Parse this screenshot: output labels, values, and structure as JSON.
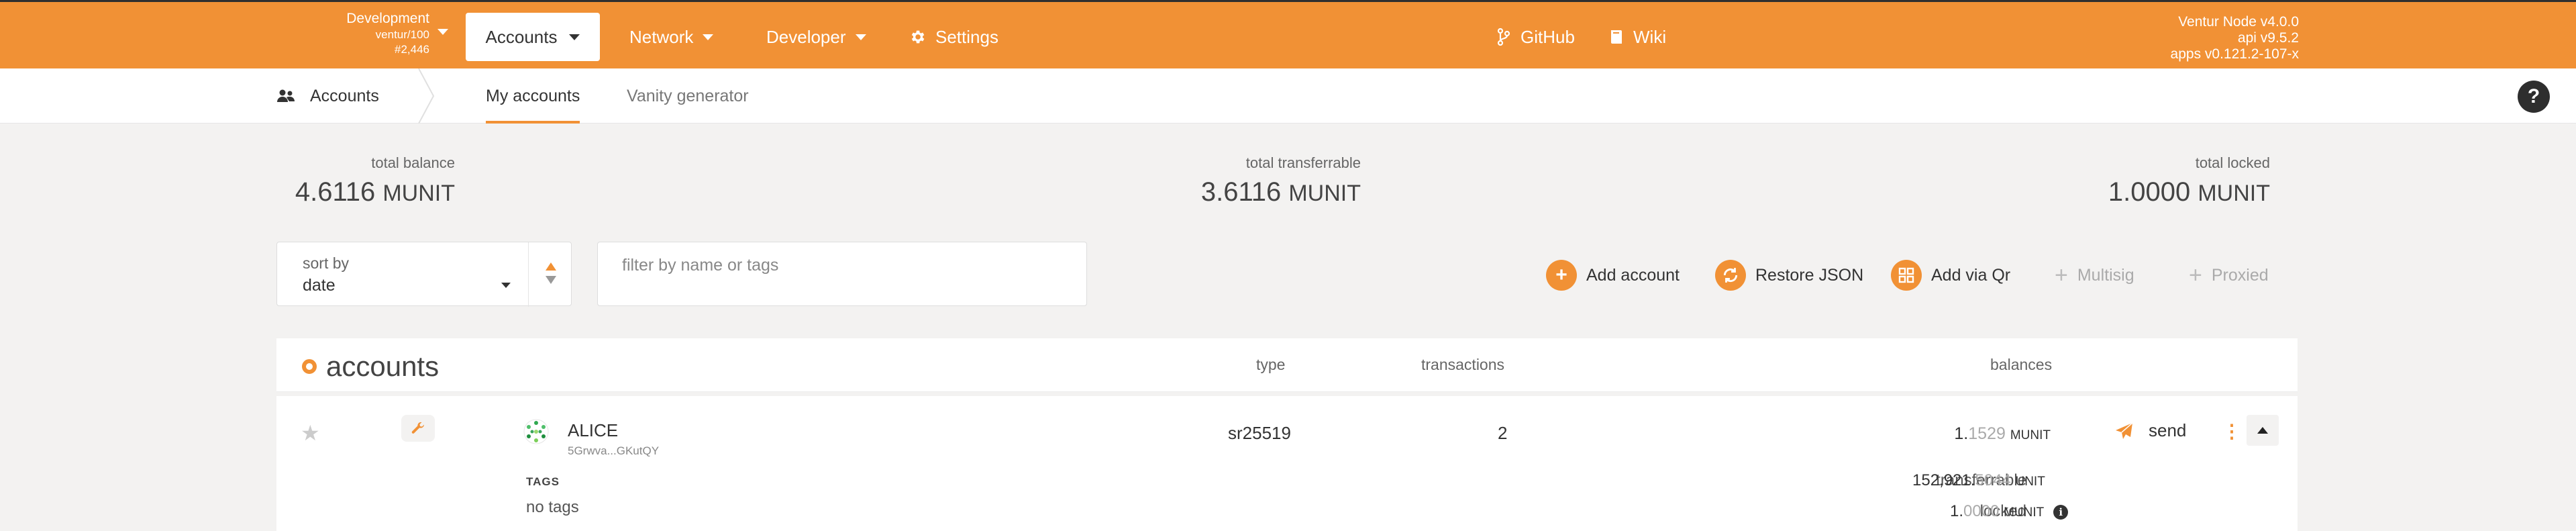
{
  "colors": {
    "accent": "#f19135",
    "top_border": "#2f2f2f"
  },
  "topbar": {
    "chain": {
      "name": "Development",
      "node": "ventur/100",
      "block": "#2,446"
    },
    "nav": {
      "accounts": "Accounts",
      "network": "Network",
      "developer": "Developer",
      "settings": "Settings",
      "github": "GitHub",
      "wiki": "Wiki"
    },
    "version": {
      "node": "Ventur Node v4.0.0",
      "api": "api v9.5.2",
      "apps": "apps v0.121.2-107-x"
    }
  },
  "subbar": {
    "section": "Accounts",
    "tabs": [
      {
        "label": "My accounts",
        "active": true
      },
      {
        "label": "Vanity generator",
        "active": false
      }
    ],
    "help": "?"
  },
  "summary": {
    "total_balance": {
      "label": "total balance",
      "int": "4.6116",
      "unit": "MUNIT"
    },
    "total_transferrable": {
      "label": "total transferrable",
      "int": "3.6116",
      "unit": "MUNIT"
    },
    "total_locked": {
      "label": "total locked",
      "int": "1.0000",
      "unit": "MUNIT"
    }
  },
  "controls": {
    "sort": {
      "label": "sort by",
      "value": "date"
    },
    "filter": {
      "placeholder": "filter by name or tags"
    },
    "actions": {
      "add_account": "Add account",
      "restore_json": "Restore JSON",
      "add_qr": "Add via Qr",
      "multisig": "Multisig",
      "proxied": "Proxied"
    }
  },
  "table": {
    "title": "accounts",
    "columns": {
      "type": "type",
      "transactions": "transactions",
      "balances": "balances"
    },
    "rows": [
      {
        "name": "ALICE",
        "address": "5Grwva...GKutQY",
        "type": "sr25519",
        "transactions": "2",
        "balance": {
          "int": "1.",
          "frac": "1529",
          "unit": "MUNIT"
        },
        "send": "send",
        "tags_label": "TAGS",
        "tags": "no tags",
        "transferrable": {
          "label": "transferrable",
          "int": "152,921.",
          "frac": "5044",
          "unit": "UNIT"
        },
        "locked": {
          "label": "locked",
          "int": "1.",
          "frac": "0000",
          "unit": "MUNIT"
        }
      }
    ]
  }
}
